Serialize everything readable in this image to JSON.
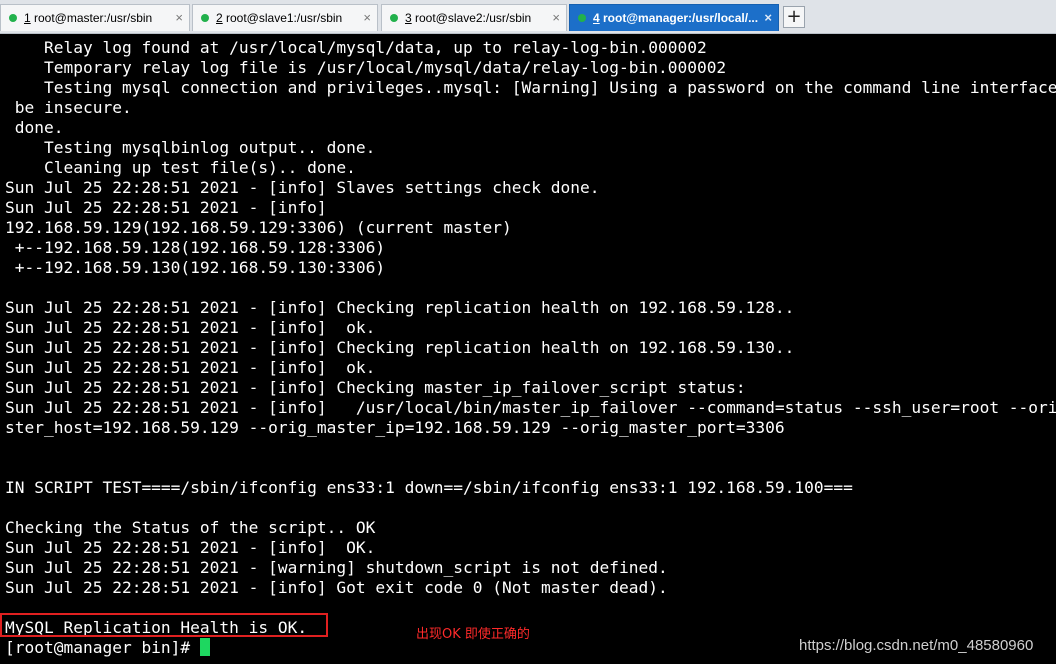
{
  "tabs": [
    {
      "number": "1",
      "title": "root@master:/usr/sbin",
      "close": "×",
      "active": false,
      "status_color": "#22b14c"
    },
    {
      "number": "2",
      "title": "root@slave1:/usr/sbin",
      "close": "×",
      "active": false,
      "status_color": "#22b14c"
    },
    {
      "number": "3",
      "title": "root@slave2:/usr/sbin",
      "close": "×",
      "active": false,
      "status_color": "#22b14c"
    },
    {
      "number": "4",
      "title": "root@manager:/usr/local/...",
      "close": "×",
      "active": true,
      "status_color": "#22b14c"
    }
  ],
  "add_tab_label": "+",
  "terminal": {
    "lines": [
      "    Relay log found at /usr/local/mysql/data, up to relay-log-bin.000002",
      "    Temporary relay log file is /usr/local/mysql/data/relay-log-bin.000002",
      "    Testing mysql connection and privileges..mysql: [Warning] Using a password on the command line interface can",
      " be insecure.",
      " done.",
      "    Testing mysqlbinlog output.. done.",
      "    Cleaning up test file(s).. done.",
      "Sun Jul 25 22:28:51 2021 - [info] Slaves settings check done.",
      "Sun Jul 25 22:28:51 2021 - [info]",
      "192.168.59.129(192.168.59.129:3306) (current master)",
      " +--192.168.59.128(192.168.59.128:3306)",
      " +--192.168.59.130(192.168.59.130:3306)",
      "",
      "Sun Jul 25 22:28:51 2021 - [info] Checking replication health on 192.168.59.128..",
      "Sun Jul 25 22:28:51 2021 - [info]  ok.",
      "Sun Jul 25 22:28:51 2021 - [info] Checking replication health on 192.168.59.130..",
      "Sun Jul 25 22:28:51 2021 - [info]  ok.",
      "Sun Jul 25 22:28:51 2021 - [info] Checking master_ip_failover_script status:",
      "Sun Jul 25 22:28:51 2021 - [info]   /usr/local/bin/master_ip_failover --command=status --ssh_user=root --orig_ma",
      "ster_host=192.168.59.129 --orig_master_ip=192.168.59.129 --orig_master_port=3306",
      "",
      "",
      "IN SCRIPT TEST====/sbin/ifconfig ens33:1 down==/sbin/ifconfig ens33:1 192.168.59.100===",
      "",
      "Checking the Status of the script.. OK",
      "Sun Jul 25 22:28:51 2021 - [info]  OK.",
      "Sun Jul 25 22:28:51 2021 - [warning] shutdown_script is not defined.",
      "Sun Jul 25 22:28:51 2021 - [info] Got exit code 0 (Not master dead).",
      "",
      "MySQL Replication Health is OK."
    ],
    "prompt": "[root@manager bin]# ",
    "cursor_color": "#1ed760"
  },
  "annotation": "出现OK 即使正确的",
  "watermark": "https://blog.csdn.net/m0_48580960",
  "colors": {
    "terminal_bg": "#000000",
    "terminal_fg": "#ffffff",
    "highlight_border": "#e02020",
    "annotation_text": "#ff2a2a",
    "active_tab": "#1c6fc9"
  }
}
